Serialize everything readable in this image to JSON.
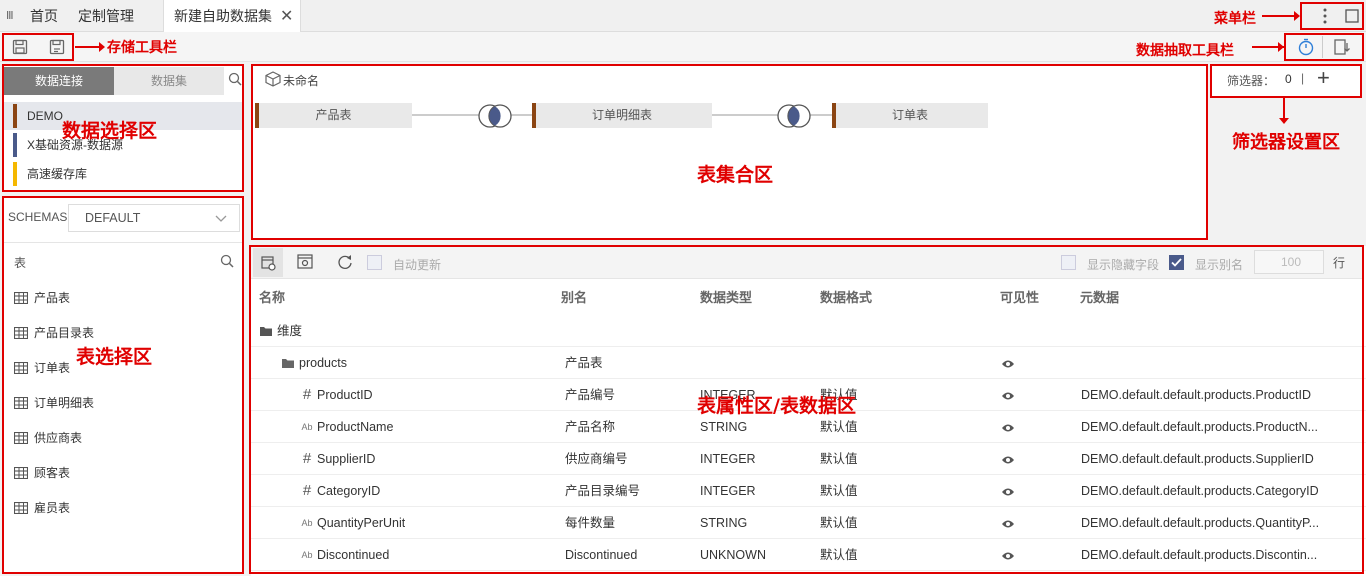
{
  "tabs": {
    "menu_glyph": "Ⅲ",
    "home": "首页",
    "custom": "定制管理",
    "active": "新建自助数据集",
    "close": "✕"
  },
  "annotations": {
    "menu_bar": "菜单栏",
    "save_toolbar": "存储工具栏",
    "extract_toolbar": "数据抽取工具栏",
    "data_select": "数据选择区",
    "table_set": "表集合区",
    "filter_area": "筛选器设置区",
    "table_select": "表选择区",
    "table_props": "表属性区/表数据区"
  },
  "source_panel": {
    "tab_connection": "数据连接",
    "tab_dataset": "数据集",
    "items": [
      {
        "label": "DEMO",
        "color": "#8b4513"
      },
      {
        "label": "X基础资源-数据源",
        "color": "#4a5a8a"
      },
      {
        "label": "高速缓存库",
        "color": "#f5b800"
      }
    ]
  },
  "schema_panel": {
    "label": "SCHEMAS",
    "value": "DEFAULT",
    "table_header": "表",
    "tables": [
      "产品表",
      "产品目录表",
      "订单表",
      "订单明细表",
      "供应商表",
      "顾客表",
      "雇员表"
    ]
  },
  "canvas": {
    "name": "未命名",
    "nodes": [
      "产品表",
      "订单明细表",
      "订单表"
    ]
  },
  "filter": {
    "label": "筛选器：",
    "count": "0",
    "sep": "|",
    "add": "+"
  },
  "props_toolbar": {
    "auto_update": "自动更新",
    "show_hidden": "显示隐藏字段",
    "show_alias": "显示别名",
    "rows_value": "100",
    "rows_unit": "行"
  },
  "grid": {
    "headers": [
      "名称",
      "别名",
      "数据类型",
      "数据格式",
      "可见性",
      "元数据"
    ],
    "dimension_label": "维度",
    "folder": {
      "name": "products",
      "alias": "产品表"
    },
    "rows": [
      {
        "type_icon": "#",
        "name": "ProductID",
        "alias": "产品编号",
        "dtype": "INTEGER",
        "fmt": "默认值",
        "meta": "DEMO.default.default.products.ProductID"
      },
      {
        "type_icon": "Ab",
        "name": "ProductName",
        "alias": "产品名称",
        "dtype": "STRING",
        "fmt": "默认值",
        "meta": "DEMO.default.default.products.ProductN..."
      },
      {
        "type_icon": "#",
        "name": "SupplierID",
        "alias": "供应商编号",
        "dtype": "INTEGER",
        "fmt": "默认值",
        "meta": "DEMO.default.default.products.SupplierID"
      },
      {
        "type_icon": "#",
        "name": "CategoryID",
        "alias": "产品目录编号",
        "dtype": "INTEGER",
        "fmt": "默认值",
        "meta": "DEMO.default.default.products.CategoryID"
      },
      {
        "type_icon": "Ab",
        "name": "QuantityPerUnit",
        "alias": "每件数量",
        "dtype": "STRING",
        "fmt": "默认值",
        "meta": "DEMO.default.default.products.QuantityP..."
      },
      {
        "type_icon": "Ab",
        "name": "Discontinued",
        "alias": "Discontinued",
        "dtype": "UNKNOWN",
        "fmt": "默认值",
        "meta": "DEMO.default.default.products.Discontin..."
      }
    ]
  }
}
